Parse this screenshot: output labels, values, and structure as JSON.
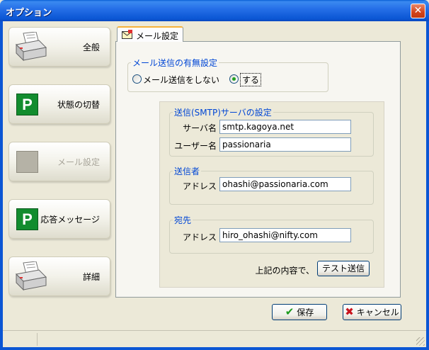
{
  "window": {
    "title": "オプション",
    "close_icon": "close-icon"
  },
  "sidebar": {
    "items": [
      {
        "label": "全般",
        "icon": "printer-icon",
        "enabled": true
      },
      {
        "label": "状態の切替",
        "icon": "p-icon",
        "icon_text": "P",
        "enabled": true
      },
      {
        "label": "メール設定",
        "icon": "mail-settings-icon",
        "enabled": false
      },
      {
        "label": "応答メッセージ",
        "icon": "p-icon",
        "icon_text": "P",
        "enabled": true
      },
      {
        "label": "詳細",
        "icon": "printer-icon",
        "enabled": true
      }
    ]
  },
  "tab": {
    "label": "メール設定",
    "icon": "mail-tab-icon"
  },
  "send_setting": {
    "group_title": "メール送信の有無設定",
    "option_no": "メール送信をしない",
    "option_yes": "する",
    "selected": "する"
  },
  "smtp": {
    "group_title": "送信(SMTP)サーバの設定",
    "server_label": "サーバ名",
    "server_value": "smtp.kagoya.net",
    "user_label": "ユーザー名",
    "user_value": "passionaria"
  },
  "sender": {
    "group_title": "送信者",
    "address_label": "アドレス",
    "address_value": "ohashi@passionaria.com"
  },
  "recipient": {
    "group_title": "宛先",
    "address_label": "アドレス",
    "address_value": "hiro_ohashi@nifty.com"
  },
  "test": {
    "prompt": "上記の内容で、",
    "button": "テスト送信"
  },
  "footer": {
    "save": "保存",
    "cancel": "キャンセル"
  },
  "colors": {
    "title_bar": "#0B56D4",
    "group_title": "#0046D5",
    "p_icon": "#128C2E",
    "background": "#ECE9D8"
  }
}
